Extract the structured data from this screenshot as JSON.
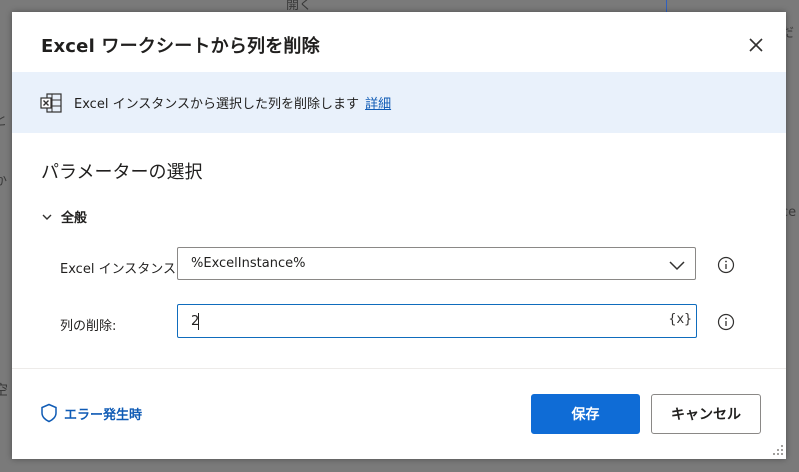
{
  "background": {
    "fragment_top": "開く",
    "fragment_right1": "だ",
    "fragment_right2": "ce",
    "fragment_left1": "と",
    "fragment_left2": "か",
    "fragment_left3": "空"
  },
  "dialog": {
    "title": "Excel ワークシートから列を削除",
    "close_icon": "close-icon",
    "banner": {
      "icon": "excel-icon",
      "text": "Excel インスタンスから選択した列を削除します",
      "link": "詳細"
    },
    "section_title": "パラメーターの選択",
    "group": {
      "label": "全般",
      "expanded": true
    },
    "fields": {
      "instance": {
        "label": "Excel インスタンス:",
        "value": "%ExcelInstance%"
      },
      "column": {
        "label": "列の削除:",
        "value": "2",
        "variable_button": "{x}"
      }
    },
    "footer": {
      "error_link": "エラー発生時",
      "save_label": "保存",
      "cancel_label": "キャンセル"
    }
  },
  "colors": {
    "accent": "#0f6cd6",
    "link": "#0f5bb5",
    "banner_bg": "#e9f1fb"
  }
}
